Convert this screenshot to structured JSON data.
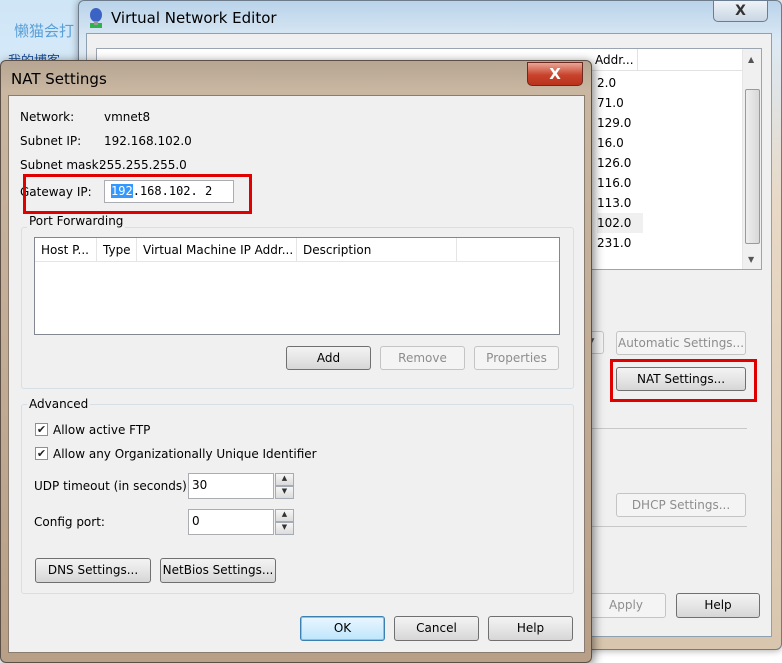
{
  "background": {
    "text1": "懒猫会打",
    "text2": "我的博客"
  },
  "vne": {
    "title": "Virtual Network Editor",
    "close_label": "X",
    "list_rows": [
      "2.0",
      "71.0",
      "129.0",
      "16.0",
      "126.0",
      "116.0",
      "113.0",
      "102.0",
      "231.0"
    ],
    "list_header_last": "Addr...",
    "selected_row": 7,
    "automatic_settings": "Automatic Settings...",
    "nat_settings": "NAT Settings...",
    "dhcp_settings": "DHCP Settings...",
    "apply": "Apply",
    "help": "Help"
  },
  "nat": {
    "title": "NAT Settings",
    "close_label": "X",
    "network_label": "Network:",
    "network_value": "vmnet8",
    "subnet_ip_label": "Subnet IP:",
    "subnet_ip_value": "192.168.102.0",
    "subnet_mask_label": "Subnet mask:",
    "subnet_mask_value": "255.255.255.0",
    "gateway_label": "Gateway IP:",
    "gateway_octets": [
      "192",
      "168",
      "102",
      "2"
    ],
    "port_forwarding": {
      "title": "Port Forwarding",
      "columns": [
        "Host P...",
        "Type",
        "Virtual Machine IP Addr...",
        "Description"
      ],
      "rows": [],
      "add": "Add",
      "remove": "Remove",
      "properties": "Properties"
    },
    "advanced": {
      "title": "Advanced",
      "allow_ftp": "Allow active FTP",
      "allow_ftp_checked": true,
      "allow_oui": "Allow any Organizationally Unique Identifier",
      "allow_oui_checked": true,
      "udp_label": "UDP timeout (in seconds):",
      "udp_value": "30",
      "config_port_label": "Config port:",
      "config_port_value": "0",
      "dns": "DNS Settings...",
      "netbios": "NetBios Settings..."
    },
    "ok": "OK",
    "cancel": "Cancel",
    "help": "Help"
  }
}
